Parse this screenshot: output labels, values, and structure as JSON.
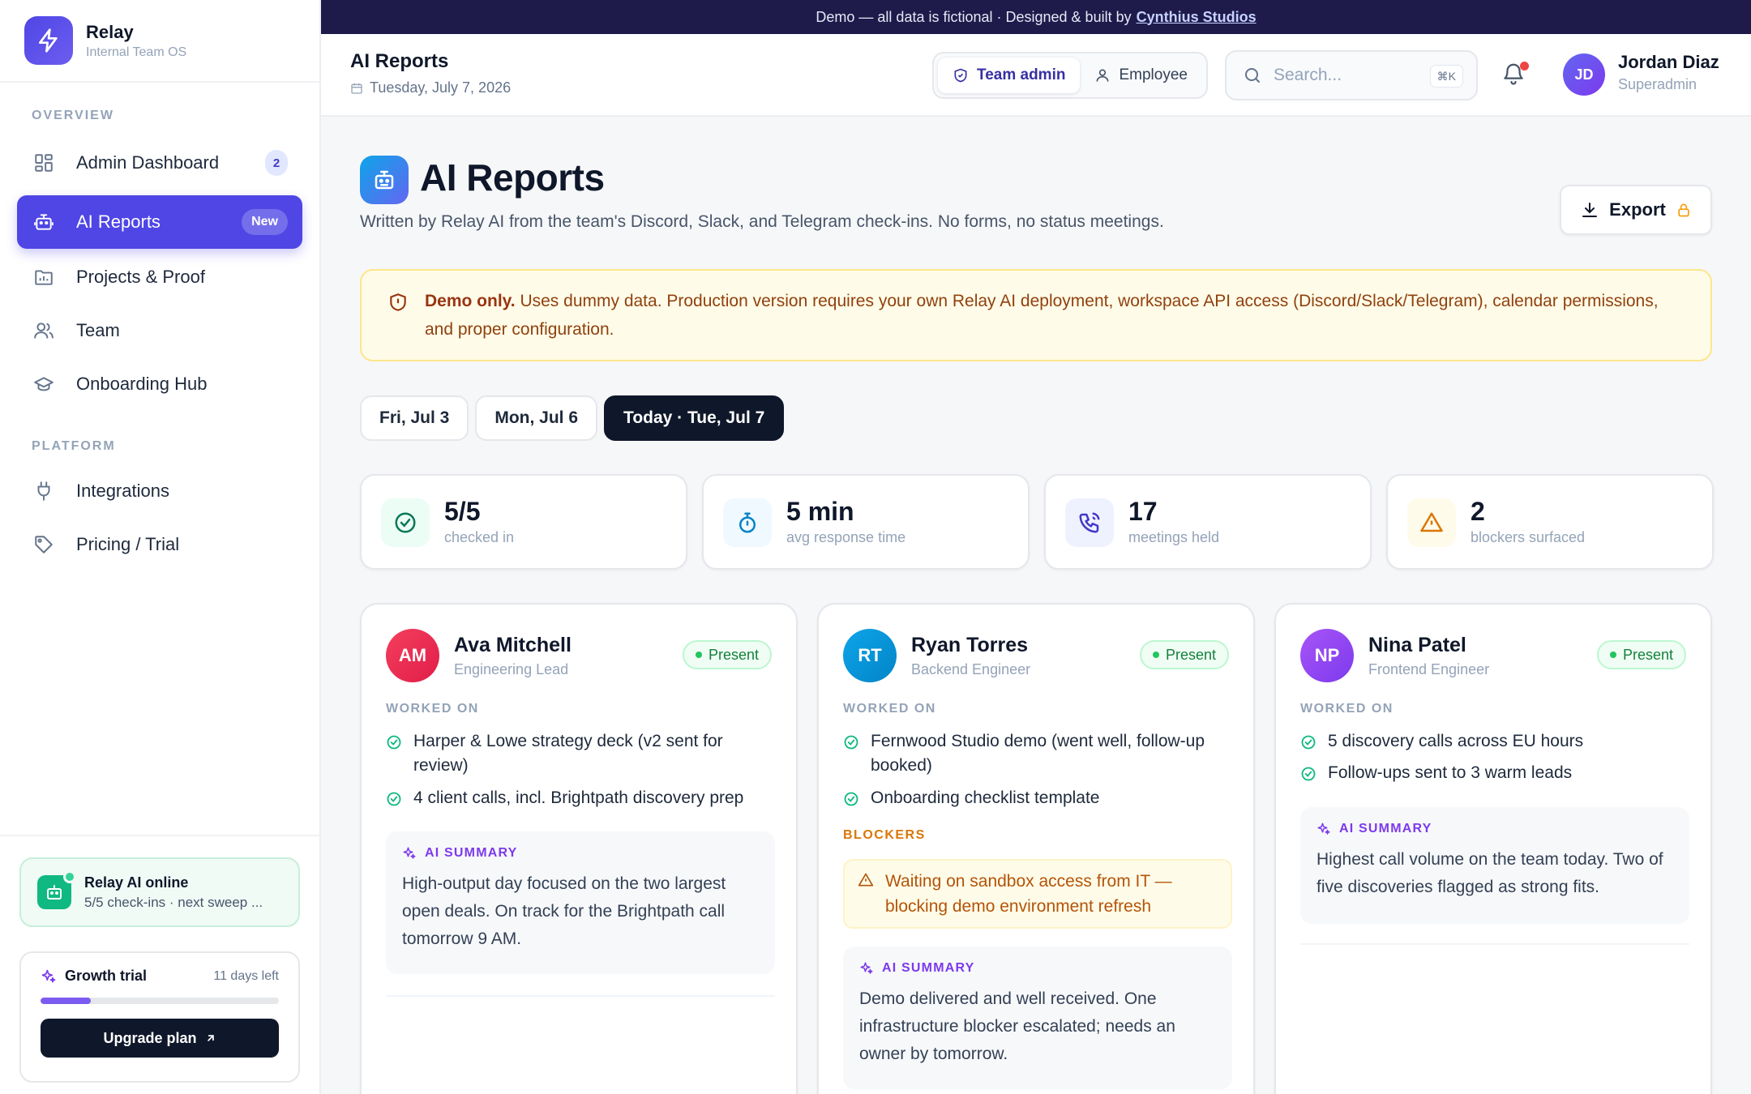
{
  "banner": {
    "text": "Demo — all data is fictional · Designed & built by",
    "link": "Cynthius Studios"
  },
  "brand": {
    "name": "Relay",
    "sub": "Internal Team OS"
  },
  "sidebar": {
    "sections": [
      "OVERVIEW",
      "PLATFORM"
    ],
    "items": [
      {
        "label": "Admin Dashboard",
        "badge": "2",
        "icon": "dashboard-grid-icon"
      },
      {
        "label": "AI Reports",
        "badge": "New",
        "icon": "robot-icon"
      },
      {
        "label": "Projects & Proof",
        "icon": "folder-chart-icon"
      },
      {
        "label": "Team",
        "icon": "users-icon"
      },
      {
        "label": "Onboarding Hub",
        "icon": "graduation-cap-icon"
      },
      {
        "label": "Integrations",
        "icon": "plug-icon"
      },
      {
        "label": "Pricing / Trial",
        "icon": "tag-icon"
      }
    ],
    "ai_status": {
      "title": "Relay AI online",
      "sub": "5/5 check-ins · next sweep ..."
    },
    "trial": {
      "title": "Growth trial",
      "days_left": "11 days left",
      "progress": 0.21,
      "cta": "Upgrade plan"
    }
  },
  "topbar": {
    "title": "AI Reports",
    "date": "Tuesday, July 7, 2026",
    "roles": [
      "Team admin",
      "Employee"
    ],
    "active_role": "Team admin",
    "search_placeholder": "Search...",
    "search_shortcut": "⌘K",
    "user": {
      "initials": "JD",
      "name": "Jordan Diaz",
      "role": "Superadmin"
    }
  },
  "page": {
    "title": "AI Reports",
    "subtitle": "Written by Relay AI from the team's Discord, Slack, and Telegram check-ins. No forms, no status meetings.",
    "export_label": "Export",
    "notice_bold": "Demo only.",
    "notice_text": " Uses dummy data. Production version requires your own Relay AI deployment, workspace API access (Discord/Slack/Telegram), calendar permissions, and proper configuration.",
    "day_tabs": [
      "Fri, Jul 3",
      "Mon, Jul 6",
      "Today · Tue, Jul 7"
    ],
    "active_day": "Today · Tue, Jul 7"
  },
  "stats": [
    {
      "value": "5/5",
      "label": "checked in",
      "icon": "check-circle-icon"
    },
    {
      "value": "5 min",
      "label": "avg response time",
      "icon": "stopwatch-icon"
    },
    {
      "value": "17",
      "label": "meetings held",
      "icon": "phone-icon"
    },
    {
      "value": "2",
      "label": "blockers surfaced",
      "icon": "warning-triangle-icon"
    }
  ],
  "people": [
    {
      "initials": "AM",
      "name": "Ava Mitchell",
      "role": "Engineering Lead",
      "status": "Present",
      "section_worked": "WORKED ON",
      "worked_on": [
        "Harper & Lowe strategy deck (v2 sent for review)",
        "4 client calls, incl. Brightpath discovery prep"
      ],
      "summary_label": "AI SUMMARY",
      "summary": "High-output day focused on the two largest open deals. On track for the Brightpath call tomorrow 9 AM."
    },
    {
      "initials": "RT",
      "name": "Ryan Torres",
      "role": "Backend Engineer",
      "status": "Present",
      "section_worked": "WORKED ON",
      "worked_on": [
        "Fernwood Studio demo (went well, follow-up booked)",
        "Onboarding checklist template"
      ],
      "section_blockers": "BLOCKERS",
      "blocker": "Waiting on sandbox access from IT — blocking demo environment refresh",
      "summary_label": "AI SUMMARY",
      "summary": "Demo delivered and well received. One infrastructure blocker escalated; needs an owner by tomorrow."
    },
    {
      "initials": "NP",
      "name": "Nina Patel",
      "role": "Frontend Engineer",
      "status": "Present",
      "section_worked": "WORKED ON",
      "worked_on": [
        "5 discovery calls across EU hours",
        "Follow-ups sent to 3 warm leads"
      ],
      "summary_label": "AI SUMMARY",
      "summary": "Highest call volume on the team today. Two of five discoveries flagged as strong fits."
    }
  ]
}
